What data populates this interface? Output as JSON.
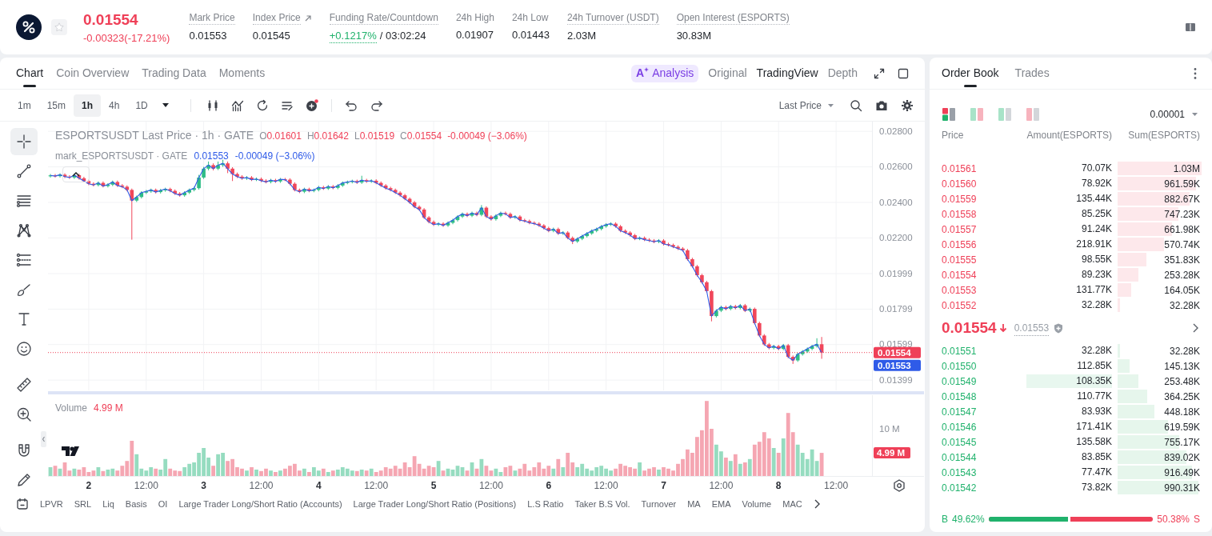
{
  "header": {
    "starred": false,
    "price": "0.01554",
    "change": "-0.00323(-17.21%)",
    "stats": [
      {
        "kind": "tip",
        "label": "Mark Price",
        "value": "0.01553"
      },
      {
        "kind": "link",
        "label": "Index Price",
        "value": "0.01545"
      },
      {
        "kind": "funding",
        "label": "Funding Rate/Countdown",
        "rate": "+0.1217%",
        "countdown": "/ 03:02:24"
      },
      {
        "kind": "plain",
        "label": "24h High",
        "value": "0.01907"
      },
      {
        "kind": "plain",
        "label": "24h Low",
        "value": "0.01443"
      },
      {
        "kind": "tip",
        "label": "24h Turnover (USDT)",
        "value": "2.03M"
      },
      {
        "kind": "tip",
        "label": "Open Interest (ESPORTS)",
        "value": "30.83M"
      }
    ]
  },
  "chart_panel": {
    "tabs": [
      {
        "label": "Chart",
        "selected": true
      },
      {
        "label": "Coin Overview",
        "selected": false
      },
      {
        "label": "Trading Data",
        "selected": false
      },
      {
        "label": "Moments",
        "selected": false
      }
    ],
    "analysis": {
      "mark": "A",
      "label": "Analysis"
    },
    "views": [
      {
        "label": "Original",
        "selected": false
      },
      {
        "label": "TradingView",
        "selected": true
      },
      {
        "label": "Depth",
        "selected": false
      }
    ],
    "intervals": [
      {
        "label": "1m",
        "selected": false
      },
      {
        "label": "15m",
        "selected": false
      },
      {
        "label": "1h",
        "selected": true
      },
      {
        "label": "4h",
        "selected": false
      },
      {
        "label": "1D",
        "selected": false
      }
    ],
    "price_type": "Last Price",
    "tools": [
      {
        "kind": "crosshair",
        "selected": true
      },
      {
        "kind": "line",
        "selected": false
      },
      {
        "kind": "parallel",
        "selected": false
      },
      {
        "kind": "pattern",
        "selected": false
      },
      {
        "kind": "fib",
        "selected": false
      },
      {
        "kind": "brush",
        "selected": false
      },
      {
        "kind": "text",
        "selected": false
      },
      {
        "kind": "emoji",
        "selected": false
      },
      {
        "kind": "ruler",
        "selected": false
      },
      {
        "kind": "zoom",
        "selected": false
      },
      {
        "kind": "magnet",
        "selected": false
      },
      {
        "kind": "pencil",
        "selected": false
      }
    ],
    "legend": {
      "title": "ESPORTSUSDT Last Price · 1h · GATE",
      "ohlc": [
        {
          "key": "O",
          "value": "0.01601"
        },
        {
          "key": "H",
          "value": "0.01642"
        },
        {
          "key": "L",
          "value": "0.01519"
        },
        {
          "key": "C",
          "value": "0.01554"
        }
      ],
      "change": "-0.00049 (−3.06%)",
      "mark_title": "mark_ESPORTSUSDT · GATE",
      "mark_value": "0.01553",
      "mark_change": "-0.00049 (−3.06%)"
    },
    "chart_data": {
      "type": "candlestick",
      "grid": true,
      "ylim": [
        0.01341,
        0.02855
      ],
      "yticks": [
        {
          "value": 0.028,
          "label": "0.02800"
        },
        {
          "value": 0.026,
          "label": "0.02600"
        },
        {
          "value": 0.024,
          "label": "0.02400"
        },
        {
          "value": 0.022,
          "label": "0.02200"
        },
        {
          "value": 0.01999,
          "label": "0.01999"
        },
        {
          "value": 0.01799,
          "label": "0.01799"
        },
        {
          "value": 0.01599,
          "label": "0.01599"
        },
        {
          "value": 0.01399,
          "label": "0.01399"
        }
      ],
      "categories": [
        null,
        null,
        null,
        null,
        null,
        null,
        null,
        null,
        null,
        null,
        null,
        null,
        null,
        null,
        null,
        null,
        null,
        null,
        null,
        null,
        null,
        null,
        null,
        null,
        null,
        null,
        null,
        null,
        null,
        null,
        null,
        null,
        null,
        null,
        null,
        null,
        null,
        null,
        null,
        null,
        null,
        null,
        null,
        null,
        null,
        null,
        null,
        null,
        null,
        null,
        null,
        null,
        null,
        null,
        null,
        null,
        null,
        null,
        null,
        null,
        null,
        null,
        null,
        null,
        null,
        null,
        null,
        null,
        null,
        null,
        null,
        null,
        null,
        null,
        null,
        null,
        null,
        null,
        null,
        null,
        null,
        null,
        null,
        null,
        null,
        null,
        null,
        null,
        null,
        null,
        null,
        null,
        null,
        null,
        null,
        null,
        null,
        null,
        null,
        null,
        null,
        null,
        null,
        null,
        null,
        null,
        null,
        null,
        null,
        null,
        null,
        null,
        null,
        null,
        null,
        null,
        null,
        null,
        null,
        null,
        null,
        null,
        null,
        null,
        null,
        null,
        null,
        null,
        null,
        null,
        null,
        null,
        null,
        null,
        null,
        null,
        null,
        null,
        null,
        null,
        null,
        null,
        null,
        null,
        null,
        null,
        null,
        null,
        null,
        null,
        null,
        null,
        null,
        null,
        null,
        null,
        null,
        null,
        null,
        null,
        null,
        null,
        null,
        null,
        null,
        null,
        null,
        null,
        null,
        null,
        null,
        null
      ],
      "ohlc": [
        [
          0.02548,
          0.0256,
          0.0254,
          0.02552
        ],
        [
          0.02552,
          0.0256,
          0.0254,
          0.02548
        ],
        [
          0.02548,
          0.02564,
          0.0254,
          0.02556
        ],
        [
          0.02556,
          0.02564,
          0.02537,
          0.02545
        ],
        [
          0.02545,
          0.02553,
          0.02532,
          0.0254
        ],
        [
          0.0254,
          0.02561,
          0.02532,
          0.02553
        ],
        [
          0.02553,
          0.02561,
          0.02528,
          0.02536
        ],
        [
          0.02536,
          0.02544,
          0.02512,
          0.0252
        ],
        [
          0.0252,
          0.02528,
          0.02497,
          0.02505
        ],
        [
          0.02505,
          0.02513,
          0.0249,
          0.02498
        ],
        [
          0.02498,
          0.02518,
          0.0249,
          0.0251
        ],
        [
          0.0251,
          0.02518,
          0.02484,
          0.02492
        ],
        [
          0.02492,
          0.02508,
          0.02484,
          0.025
        ],
        [
          0.025,
          0.02523,
          0.02492,
          0.02515
        ],
        [
          0.02515,
          0.02523,
          0.02487,
          0.02495
        ],
        [
          0.02495,
          0.02503,
          0.0248,
          0.02488
        ],
        [
          0.02488,
          0.02496,
          0.02462,
          0.0247
        ],
        [
          0.0247,
          0.02478,
          0.0219,
          0.0241
        ],
        [
          0.0241,
          0.02438,
          0.02402,
          0.0243
        ],
        [
          0.0243,
          0.02463,
          0.02422,
          0.02455
        ],
        [
          0.02455,
          0.0247,
          0.02447,
          0.02462
        ],
        [
          0.02462,
          0.02478,
          0.02454,
          0.0247
        ],
        [
          0.0247,
          0.02478,
          0.0245,
          0.02458
        ],
        [
          0.02458,
          0.02476,
          0.0245,
          0.02468
        ],
        [
          0.02468,
          0.02483,
          0.0246,
          0.02475
        ],
        [
          0.02475,
          0.02483,
          0.02457,
          0.02465
        ],
        [
          0.02465,
          0.02473,
          0.02442,
          0.0245
        ],
        [
          0.0245,
          0.02458,
          0.02432,
          0.0244
        ],
        [
          0.0244,
          0.02463,
          0.02432,
          0.02455
        ],
        [
          0.02455,
          0.02478,
          0.02447,
          0.0247
        ],
        [
          0.0247,
          0.02488,
          0.02462,
          0.0248
        ],
        [
          0.0248,
          0.02555,
          0.02472,
          0.0254
        ],
        [
          0.0254,
          0.026,
          0.02532,
          0.0259
        ],
        [
          0.0259,
          0.0263,
          0.0258,
          0.0261
        ],
        [
          0.0261,
          0.0262,
          0.0258,
          0.0259
        ],
        [
          0.0259,
          0.0263,
          0.02582,
          0.0261
        ],
        [
          0.0261,
          0.0264,
          0.026,
          0.0262
        ],
        [
          0.0262,
          0.0263,
          0.02565,
          0.0259
        ],
        [
          0.0259,
          0.02598,
          0.0252,
          0.0256
        ],
        [
          0.0256,
          0.02568,
          0.02537,
          0.02545
        ],
        [
          0.02545,
          0.02553,
          0.02527,
          0.02535
        ],
        [
          0.02535,
          0.02548,
          0.02527,
          0.0254
        ],
        [
          0.0254,
          0.02548,
          0.0252,
          0.02528
        ],
        [
          0.02528,
          0.0254,
          0.0252,
          0.02532
        ],
        [
          0.02532,
          0.0254,
          0.02514,
          0.02522
        ],
        [
          0.02522,
          0.0253,
          0.02507,
          0.02515
        ],
        [
          0.02515,
          0.02533,
          0.02507,
          0.02525
        ],
        [
          0.02525,
          0.02533,
          0.0251,
          0.02518
        ],
        [
          0.02518,
          0.02538,
          0.0251,
          0.0253
        ],
        [
          0.0253,
          0.02538,
          0.0252,
          0.02528
        ],
        [
          0.02528,
          0.02536,
          0.02497,
          0.02505
        ],
        [
          0.02505,
          0.02513,
          0.02462,
          0.0247
        ],
        [
          0.0247,
          0.02478,
          0.02452,
          0.0246
        ],
        [
          0.0246,
          0.02483,
          0.02452,
          0.02475
        ],
        [
          0.02475,
          0.02483,
          0.02457,
          0.02465
        ],
        [
          0.02465,
          0.02478,
          0.02457,
          0.0247
        ],
        [
          0.0247,
          0.02493,
          0.02462,
          0.02485
        ],
        [
          0.02485,
          0.02493,
          0.0247,
          0.02478
        ],
        [
          0.02478,
          0.02498,
          0.0247,
          0.0249
        ],
        [
          0.0249,
          0.02498,
          0.02474,
          0.02482
        ],
        [
          0.02482,
          0.02503,
          0.02474,
          0.02495
        ],
        [
          0.02495,
          0.02518,
          0.02487,
          0.0251
        ],
        [
          0.0251,
          0.02523,
          0.02502,
          0.02515
        ],
        [
          0.02515,
          0.02528,
          0.02507,
          0.0252
        ],
        [
          0.0252,
          0.02528,
          0.02504,
          0.02512
        ],
        [
          0.02512,
          0.0255,
          0.02504,
          0.02525
        ],
        [
          0.02525,
          0.02533,
          0.0251,
          0.02518
        ],
        [
          0.02518,
          0.0253,
          0.0251,
          0.02522
        ],
        [
          0.02522,
          0.0253,
          0.02502,
          0.0251
        ],
        [
          0.0251,
          0.02518,
          0.02487,
          0.02495
        ],
        [
          0.02495,
          0.02503,
          0.02472,
          0.0248
        ],
        [
          0.0248,
          0.02488,
          0.02462,
          0.0247
        ],
        [
          0.0247,
          0.02478,
          0.02447,
          0.02455
        ],
        [
          0.02455,
          0.02463,
          0.02432,
          0.0244
        ],
        [
          0.0244,
          0.02448,
          0.02412,
          0.0242
        ],
        [
          0.0242,
          0.02428,
          0.02392,
          0.024
        ],
        [
          0.024,
          0.02408,
          0.02367,
          0.02375
        ],
        [
          0.02375,
          0.02383,
          0.02352,
          0.0236
        ],
        [
          0.0236,
          0.02368,
          0.02307,
          0.02315
        ],
        [
          0.02315,
          0.02323,
          0.02282,
          0.0229
        ],
        [
          0.0229,
          0.02298,
          0.02267,
          0.02275
        ],
        [
          0.02275,
          0.02288,
          0.02267,
          0.0228
        ],
        [
          0.0228,
          0.02288,
          0.02262,
          0.0227
        ],
        [
          0.0227,
          0.02293,
          0.02262,
          0.02285
        ],
        [
          0.02285,
          0.02308,
          0.02277,
          0.023
        ],
        [
          0.023,
          0.02328,
          0.02292,
          0.0232
        ],
        [
          0.0232,
          0.02343,
          0.02312,
          0.02335
        ],
        [
          0.02335,
          0.02343,
          0.02317,
          0.02325
        ],
        [
          0.02325,
          0.02348,
          0.02317,
          0.0234
        ],
        [
          0.0234,
          0.02348,
          0.02322,
          0.0233
        ],
        [
          0.0233,
          0.02385,
          0.02322,
          0.0237
        ],
        [
          0.0237,
          0.02378,
          0.02312,
          0.0232
        ],
        [
          0.0232,
          0.02328,
          0.02297,
          0.02305
        ],
        [
          0.02305,
          0.02333,
          0.02297,
          0.02325
        ],
        [
          0.02325,
          0.02348,
          0.02317,
          0.0234
        ],
        [
          0.0234,
          0.02348,
          0.02327,
          0.02335
        ],
        [
          0.02335,
          0.02343,
          0.02307,
          0.02315
        ],
        [
          0.02315,
          0.02328,
          0.02307,
          0.0232
        ],
        [
          0.0232,
          0.02328,
          0.02292,
          0.023
        ],
        [
          0.023,
          0.02308,
          0.02287,
          0.02295
        ],
        [
          0.02295,
          0.02303,
          0.02277,
          0.02285
        ],
        [
          0.02285,
          0.02293,
          0.02272,
          0.0228
        ],
        [
          0.0228,
          0.02288,
          0.02262,
          0.0227
        ],
        [
          0.0227,
          0.02278,
          0.02247,
          0.02255
        ],
        [
          0.02255,
          0.02263,
          0.02232,
          0.0224
        ],
        [
          0.0224,
          0.02258,
          0.02232,
          0.0225
        ],
        [
          0.0225,
          0.02258,
          0.02217,
          0.02225
        ],
        [
          0.02225,
          0.02238,
          0.02217,
          0.0223
        ],
        [
          0.0223,
          0.02238,
          0.02192,
          0.022
        ],
        [
          0.022,
          0.02208,
          0.02165,
          0.0218
        ],
        [
          0.0218,
          0.02203,
          0.02172,
          0.02195
        ],
        [
          0.02195,
          0.02218,
          0.02187,
          0.0221
        ],
        [
          0.0221,
          0.02233,
          0.02202,
          0.02225
        ],
        [
          0.02225,
          0.02248,
          0.02217,
          0.0224
        ],
        [
          0.0224,
          0.02258,
          0.02232,
          0.0225
        ],
        [
          0.0225,
          0.02273,
          0.02242,
          0.02265
        ],
        [
          0.02265,
          0.02283,
          0.02257,
          0.02275
        ],
        [
          0.02275,
          0.02288,
          0.02267,
          0.0228
        ],
        [
          0.0228,
          0.02288,
          0.02257,
          0.02265
        ],
        [
          0.02265,
          0.02273,
          0.02232,
          0.0224
        ],
        [
          0.0224,
          0.02248,
          0.02222,
          0.0223
        ],
        [
          0.0223,
          0.02238,
          0.02207,
          0.02215
        ],
        [
          0.02215,
          0.02223,
          0.02187,
          0.02195
        ],
        [
          0.02195,
          0.02208,
          0.02187,
          0.022
        ],
        [
          0.022,
          0.02208,
          0.02182,
          0.0219
        ],
        [
          0.0219,
          0.02198,
          0.02177,
          0.02185
        ],
        [
          0.02185,
          0.02193,
          0.0217,
          0.02178
        ],
        [
          0.02178,
          0.02193,
          0.0217,
          0.02185
        ],
        [
          0.02185,
          0.02193,
          0.02157,
          0.02165
        ],
        [
          0.02165,
          0.02173,
          0.02152,
          0.0216
        ],
        [
          0.0216,
          0.02168,
          0.02142,
          0.0215
        ],
        [
          0.0215,
          0.02158,
          0.02132,
          0.0214
        ],
        [
          0.0214,
          0.02148,
          0.02122,
          0.0213
        ],
        [
          0.0213,
          0.02138,
          0.02072,
          0.0208
        ],
        [
          0.0208,
          0.02088,
          0.02032,
          0.0204
        ],
        [
          0.0204,
          0.02048,
          0.01982,
          0.0199
        ],
        [
          0.0199,
          0.01998,
          0.01942,
          0.0195
        ],
        [
          0.0195,
          0.01958,
          0.01892,
          0.019
        ],
        [
          0.019,
          0.01908,
          0.0173,
          0.0176
        ],
        [
          0.0176,
          0.01798,
          0.01752,
          0.0179
        ],
        [
          0.0179,
          0.01818,
          0.01782,
          0.0181
        ],
        [
          0.0181,
          0.01818,
          0.01792,
          0.018
        ],
        [
          0.018,
          0.01823,
          0.01792,
          0.01815
        ],
        [
          0.01815,
          0.01823,
          0.01797,
          0.01805
        ],
        [
          0.01805,
          0.01828,
          0.01797,
          0.0182
        ],
        [
          0.0182,
          0.01828,
          0.01782,
          0.0179
        ],
        [
          0.0179,
          0.01808,
          0.01782,
          0.018
        ],
        [
          0.018,
          0.01808,
          0.01712,
          0.0172
        ],
        [
          0.0172,
          0.01728,
          0.01642,
          0.0165
        ],
        [
          0.0165,
          0.01658,
          0.01592,
          0.016
        ],
        [
          0.016,
          0.01608,
          0.01572,
          0.0158
        ],
        [
          0.0158,
          0.01598,
          0.01572,
          0.0159
        ],
        [
          0.0159,
          0.01598,
          0.01567,
          0.01575
        ],
        [
          0.01575,
          0.01603,
          0.01567,
          0.01595
        ],
        [
          0.01595,
          0.01603,
          0.01522,
          0.0153
        ],
        [
          0.0153,
          0.01538,
          0.0149,
          0.0151
        ],
        [
          0.0151,
          0.01553,
          0.01502,
          0.01545
        ],
        [
          0.01545,
          0.01568,
          0.01537,
          0.0156
        ],
        [
          0.0156,
          0.01583,
          0.01552,
          0.01575
        ],
        [
          0.01575,
          0.01598,
          0.01567,
          0.0159
        ],
        [
          0.0159,
          0.01635,
          0.01582,
          0.01601
        ],
        [
          0.01601,
          0.01642,
          0.01519,
          0.01554
        ],
        null,
        null,
        null,
        null,
        null,
        null,
        null,
        null,
        null,
        null
      ],
      "series": [
        {
          "type": "line",
          "color": "#2f5be8",
          "values": [
            0.02552,
            0.02548,
            0.02556,
            0.02545,
            0.0254,
            0.02553,
            0.02536,
            0.0252,
            0.02505,
            0.02498,
            0.0251,
            0.02492,
            0.025,
            0.02515,
            0.02495,
            0.02488,
            0.0247,
            0.0241,
            0.0243,
            0.02455,
            0.02462,
            0.0247,
            0.02458,
            0.02468,
            0.02475,
            0.02465,
            0.0245,
            0.0244,
            0.02455,
            0.0247,
            0.0248,
            0.0254,
            0.0259,
            0.0261,
            0.0259,
            0.0261,
            0.0262,
            0.0259,
            0.0256,
            0.02545,
            0.02535,
            0.0254,
            0.02528,
            0.02532,
            0.02522,
            0.02515,
            0.02525,
            0.02518,
            0.0253,
            0.02528,
            0.02505,
            0.0247,
            0.0246,
            0.02475,
            0.02465,
            0.0247,
            0.02485,
            0.02478,
            0.0249,
            0.02482,
            0.02495,
            0.0251,
            0.02515,
            0.0252,
            0.02512,
            0.02525,
            0.02518,
            0.02522,
            0.0251,
            0.02495,
            0.0248,
            0.0247,
            0.02455,
            0.0244,
            0.0242,
            0.024,
            0.02375,
            0.0236,
            0.02315,
            0.0229,
            0.02275,
            0.0228,
            0.0227,
            0.02285,
            0.023,
            0.0232,
            0.02335,
            0.02325,
            0.0234,
            0.0233,
            0.0237,
            0.0232,
            0.02305,
            0.02325,
            0.0234,
            0.02335,
            0.02315,
            0.0232,
            0.023,
            0.02295,
            0.02285,
            0.0228,
            0.0227,
            0.02255,
            0.0224,
            0.0225,
            0.02225,
            0.0223,
            0.022,
            0.0218,
            0.02195,
            0.0221,
            0.02225,
            0.0224,
            0.0225,
            0.02265,
            0.02275,
            0.0228,
            0.02265,
            0.0224,
            0.0223,
            0.02215,
            0.02195,
            0.022,
            0.0219,
            0.02185,
            0.02178,
            0.02185,
            0.02165,
            0.0216,
            0.0215,
            0.0214,
            0.0213,
            0.0208,
            0.0204,
            0.0199,
            0.0195,
            0.019,
            0.0176,
            0.0179,
            0.0181,
            0.018,
            0.01815,
            0.01805,
            0.0182,
            0.0179,
            0.018,
            0.0172,
            0.0165,
            0.016,
            0.0158,
            0.0159,
            0.01575,
            0.01595,
            0.0153,
            0.0151,
            0.01545,
            0.0156,
            0.01575,
            0.0159,
            0.01601,
            0.01553,
            null,
            null,
            null,
            null,
            null,
            null,
            null,
            null,
            null,
            null
          ]
        }
      ],
      "ref_lines": [
        {
          "axis": "y",
          "value": 0.01554,
          "color": "#ef4058"
        }
      ]
    },
    "price_tags": [
      {
        "kind": "last",
        "text": "0.01554"
      },
      {
        "kind": "mark",
        "text": "0.01553"
      }
    ],
    "volume": {
      "label": "Volume",
      "value": "4.99 M",
      "chart_data": {
        "type": "bar",
        "stacked": true,
        "ylim": [
          0,
          17
        ],
        "yticks": [
          {
            "value": 10,
            "label": "10 M"
          },
          {
            "value": 4.99,
            "label": "4.99 M"
          }
        ],
        "categories": [
          null,
          null,
          null,
          null,
          null,
          null,
          null,
          null,
          "2",
          null,
          null,
          null,
          null,
          null,
          null,
          null,
          null,
          null,
          null,
          null,
          "12:00",
          null,
          null,
          null,
          null,
          null,
          null,
          null,
          null,
          null,
          null,
          null,
          "3",
          null,
          null,
          null,
          null,
          null,
          null,
          null,
          null,
          null,
          null,
          null,
          "12:00",
          null,
          null,
          null,
          null,
          null,
          null,
          null,
          null,
          null,
          null,
          null,
          "4",
          null,
          null,
          null,
          null,
          null,
          null,
          null,
          null,
          null,
          null,
          null,
          "12:00",
          null,
          null,
          null,
          null,
          null,
          null,
          null,
          null,
          null,
          null,
          null,
          "5",
          null,
          null,
          null,
          null,
          null,
          null,
          null,
          null,
          null,
          null,
          null,
          "12:00",
          null,
          null,
          null,
          null,
          null,
          null,
          null,
          null,
          null,
          null,
          null,
          "6",
          null,
          null,
          null,
          null,
          null,
          null,
          null,
          null,
          null,
          null,
          null,
          "12:00",
          null,
          null,
          null,
          null,
          null,
          null,
          null,
          null,
          null,
          null,
          null,
          "7",
          null,
          null,
          null,
          null,
          null,
          null,
          null,
          null,
          null,
          null,
          null,
          "12:00",
          null,
          null,
          null,
          null,
          null,
          null,
          null,
          null,
          null,
          null,
          null,
          "8",
          null,
          null,
          null,
          null,
          null,
          null,
          null,
          null,
          null,
          null,
          null,
          "12:00",
          null,
          null,
          null,
          null,
          null,
          null,
          null
        ],
        "series": [
          {
            "color": "#96dcc0",
            "values": [
              2,
              null,
              1.7,
              null,
              null,
              1.7,
              null,
              null,
              null,
              null,
              2,
              null,
              1.5,
              1.7,
              null,
              null,
              null,
              null,
              4.7,
              1.7,
              1.3,
              2,
              null,
              1.5,
              3.7,
              null,
              null,
              null,
              2,
              2.7,
              3,
              5,
              6,
              4,
              null,
              4.7,
              5,
              null,
              null,
              null,
              null,
              1.3,
              null,
              1.5,
              null,
              null,
              1.3,
              null,
              1.3,
              null,
              null,
              null,
              null,
              1.7,
              null,
              2,
              1.3,
              null,
              1,
              null,
              1.5,
              2,
              1.7,
              1.3,
              null,
              1.5,
              null,
              1.7,
              null,
              null,
              null,
              null,
              null,
              null,
              null,
              null,
              null,
              null,
              null,
              null,
              null,
              3.3,
              null,
              1.7,
              1.5,
              2.3,
              2,
              null,
              3,
              null,
              3.7,
              null,
              null,
              1.7,
              1,
              null,
              null,
              1.3,
              null,
              null,
              null,
              null,
              null,
              null,
              null,
              1.7,
              null,
              2,
              null,
              null,
              2,
              2.7,
              1.7,
              1.3,
              2,
              2.3,
              1.7,
              1.3,
              null,
              null,
              null,
              null,
              null,
              3,
              null,
              null,
              null,
              1.5,
              null,
              null,
              null,
              null,
              null,
              null,
              null,
              null,
              null,
              null,
              null,
              6.7,
              5.3,
              null,
              3.3,
              null,
              2.7,
              null,
              3.7,
              null,
              null,
              null,
              null,
              6,
              null,
              8,
              null,
              null,
              6.7,
              5,
              3.7,
              5.7,
              3.3,
              null,
              null,
              null,
              null,
              null,
              null,
              null,
              null,
              null,
              null,
              null
            ]
          },
          {
            "color": "#f5a6b2",
            "values": [
              null,
              2.3,
              null,
              3,
              1.3,
              null,
              1.5,
              2,
              1,
              1.3,
              null,
              1.2,
              null,
              null,
              1.3,
              2.3,
              3.3,
              7.5,
              null,
              null,
              null,
              null,
              1.7,
              null,
              null,
              1.7,
              1.3,
              1.2,
              null,
              null,
              null,
              null,
              null,
              null,
              2.3,
              null,
              null,
              3.3,
              3.7,
              2,
              1.7,
              null,
              2,
              null,
              1.2,
              1.7,
              null,
              1,
              null,
              1.7,
              2.3,
              2.7,
              1.3,
              null,
              1,
              null,
              null,
              1.7,
              null,
              1.3,
              null,
              null,
              null,
              null,
              1.2,
              null,
              1.3,
              null,
              1,
              1.3,
              2,
              1.7,
              2.3,
              1.7,
              3,
              2,
              4.3,
              2.7,
              1.7,
              2.3,
              2,
              null,
              1.3,
              null,
              null,
              null,
              null,
              1.3,
              null,
              1.7,
              null,
              2.3,
              1.3,
              null,
              null,
              2,
              2.3,
              null,
              1.7,
              2.7,
              1.3,
              2,
              3,
              1.7,
              2.3,
              null,
              3.7,
              null,
              5,
              3,
              null,
              null,
              null,
              null,
              null,
              null,
              null,
              null,
              1.7,
              2.7,
              2.3,
              2,
              1.7,
              null,
              1.3,
              1.7,
              2,
              null,
              2,
              1.7,
              1.3,
              2.7,
              3.7,
              5.7,
              5,
              8.3,
              9.7,
              15.8,
              10,
              null,
              null,
              4,
              null,
              4.7,
              null,
              3,
              null,
              6.7,
              7.3,
              9.3,
              8,
              null,
              5,
              null,
              13.3,
              9.3,
              null,
              null,
              null,
              null,
              null,
              4.99,
              null,
              null,
              null,
              null,
              null,
              null,
              null,
              null,
              null,
              null
            ]
          }
        ]
      }
    },
    "indicators": [
      "LPVR",
      "SRL",
      "Liq",
      "Basis",
      "OI",
      "Large Trader Long/Short Ratio (Accounts)",
      "Large Trader Long/Short Ratio (Positions)",
      "L.S Ratio",
      "Taker B.S Vol.",
      "Turnover",
      "MA",
      "EMA",
      "Volume",
      "MAC"
    ]
  },
  "order_book": {
    "tabs": [
      {
        "label": "Order Book",
        "selected": true
      },
      {
        "label": "Trades",
        "selected": false
      }
    ],
    "view_modes": [
      {
        "kind": "all",
        "selected": true
      },
      {
        "kind": "split",
        "selected": false
      },
      {
        "kind": "bids",
        "selected": false
      },
      {
        "kind": "asks",
        "selected": false
      }
    ],
    "precision": "0.00001",
    "columns": [
      "Price",
      "Amount(ESPORTS)",
      "Sum(ESPORTS)"
    ],
    "asks": [
      {
        "price": "0.01561",
        "amount": "70.07K",
        "sum": "1.03M",
        "level": 1.0
      },
      {
        "price": "0.01560",
        "amount": "78.92K",
        "sum": "961.59K",
        "level": 0.934
      },
      {
        "price": "0.01559",
        "amount": "135.44K",
        "sum": "882.67K",
        "level": 0.857
      },
      {
        "price": "0.01558",
        "amount": "85.25K",
        "sum": "747.23K",
        "level": 0.725
      },
      {
        "price": "0.01557",
        "amount": "91.24K",
        "sum": "661.98K",
        "level": 0.643
      },
      {
        "price": "0.01556",
        "amount": "218.91K",
        "sum": "570.74K",
        "level": 0.554
      },
      {
        "price": "0.01555",
        "amount": "98.55K",
        "sum": "351.83K",
        "level": 0.342
      },
      {
        "price": "0.01554",
        "amount": "89.23K",
        "sum": "253.28K",
        "level": 0.246
      },
      {
        "price": "0.01553",
        "amount": "131.77K",
        "sum": "164.05K",
        "level": 0.159
      },
      {
        "price": "0.01552",
        "amount": "32.28K",
        "sum": "32.28K",
        "level": 0.031
      }
    ],
    "last_price": "0.01554",
    "falling": true,
    "mark_price": "0.01553",
    "bids": [
      {
        "price": "0.01551",
        "amount": "32.28K",
        "sum": "32.28K",
        "level": 0.031,
        "highlighted": false
      },
      {
        "price": "0.01550",
        "amount": "112.85K",
        "sum": "145.13K",
        "level": 0.141,
        "highlighted": false
      },
      {
        "price": "0.01549",
        "amount": "108.35K",
        "sum": "253.48K",
        "level": 0.246,
        "highlighted": true
      },
      {
        "price": "0.01548",
        "amount": "110.77K",
        "sum": "364.25K",
        "level": 0.354,
        "highlighted": false
      },
      {
        "price": "0.01547",
        "amount": "83.93K",
        "sum": "448.18K",
        "level": 0.435,
        "highlighted": false
      },
      {
        "price": "0.01546",
        "amount": "171.41K",
        "sum": "619.59K",
        "level": 0.602,
        "highlighted": false
      },
      {
        "price": "0.01545",
        "amount": "135.58K",
        "sum": "755.17K",
        "level": 0.733,
        "highlighted": false
      },
      {
        "price": "0.01544",
        "amount": "83.85K",
        "sum": "839.02K",
        "level": 0.815,
        "highlighted": false
      },
      {
        "price": "0.01543",
        "amount": "77.47K",
        "sum": "916.49K",
        "level": 0.89,
        "highlighted": false
      },
      {
        "price": "0.01542",
        "amount": "73.82K",
        "sum": "990.31K",
        "level": 0.961,
        "highlighted": false
      }
    ],
    "ratio": {
      "buy_label": "B",
      "buy": "49.62%",
      "sell": "50.38%",
      "sell_label": "S",
      "level": 0.4962
    }
  }
}
